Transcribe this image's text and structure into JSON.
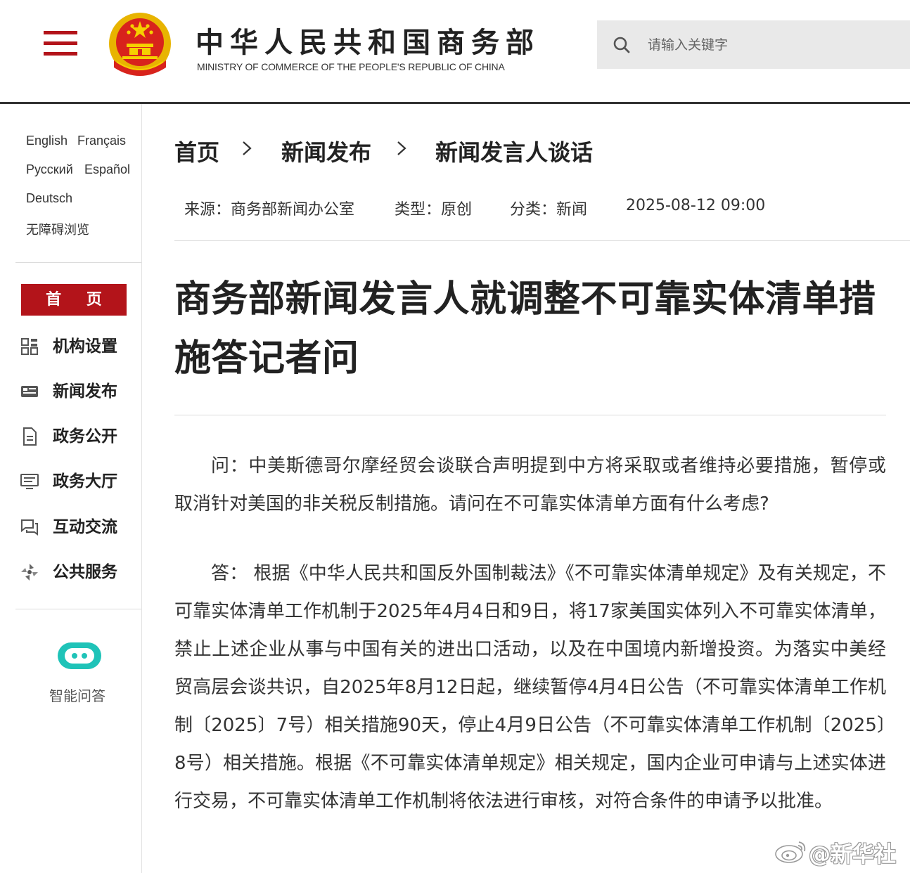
{
  "header": {
    "ministry_name_cn": "中华人民共和国商务部",
    "ministry_name_en": "MINISTRY OF COMMERCE OF THE PEOPLE'S REPUBLIC OF CHINA",
    "search_placeholder": "请输入关键字",
    "menu_icon": "hamburger-menu-icon",
    "emblem": "national-emblem",
    "search_icon": "search-icon"
  },
  "sidebar": {
    "languages": [
      "English",
      "Français",
      "Русский",
      "Español",
      "Deutsch",
      "无障碍浏览"
    ],
    "home_label": "首 页",
    "nav": [
      {
        "label": "机构设置",
        "icon": "grid-icon"
      },
      {
        "label": "新闻发布",
        "icon": "news-list-icon"
      },
      {
        "label": "政务公开",
        "icon": "document-icon"
      },
      {
        "label": "政务大厅",
        "icon": "monitor-icon"
      },
      {
        "label": "互动交流",
        "icon": "chat-icon"
      },
      {
        "label": "公共服务",
        "icon": "service-icon"
      }
    ],
    "assistant_label": "智能问答",
    "assistant_icon": "robot-icon"
  },
  "breadcrumb": [
    "首页",
    "新闻发布",
    "新闻发言人谈话"
  ],
  "meta": {
    "source": "来源：商务部新闻办公室",
    "type": "类型：原创",
    "category": "分类：新闻",
    "datetime": "2025-08-12 09:00"
  },
  "article": {
    "title": "商务部新闻发言人就调整不可靠实体清单措施答记者问",
    "question": "问：中美斯德哥尔摩经贸会谈联合声明提到中方将采取或者维持必要措施，暂停或取消针对美国的非关税反制措施。请问在不可靠实体清单方面有什么考虑?",
    "answer": "答： 根据《中华人民共和国反外国制裁法》《不可靠实体清单规定》及有关规定，不可靠实体清单工作机制于2025年4月4日和9日，将17家美国实体列入不可靠实体清单，禁止上述企业从事与中国有关的进出口活动，以及在中国境内新增投资。为落实中美经贸高层会谈共识，自2025年8月12日起，继续暂停4月4日公告（不可靠实体清单工作机制〔2025〕7号）相关措施90天，停止4月9日公告（不可靠实体清单工作机制〔2025〕8号）相关措施。根据《不可靠实体清单规定》相关规定，国内企业可申请与上述实体进行交易，不可靠实体清单工作机制将依法进行审核，对符合条件的申请予以批准。"
  },
  "watermark": {
    "text": "@新华社",
    "icon": "weibo-logo-icon"
  },
  "colors": {
    "accent_red": "#b3141a",
    "gold": "#e8b400",
    "teal": "#1fc3b8"
  }
}
